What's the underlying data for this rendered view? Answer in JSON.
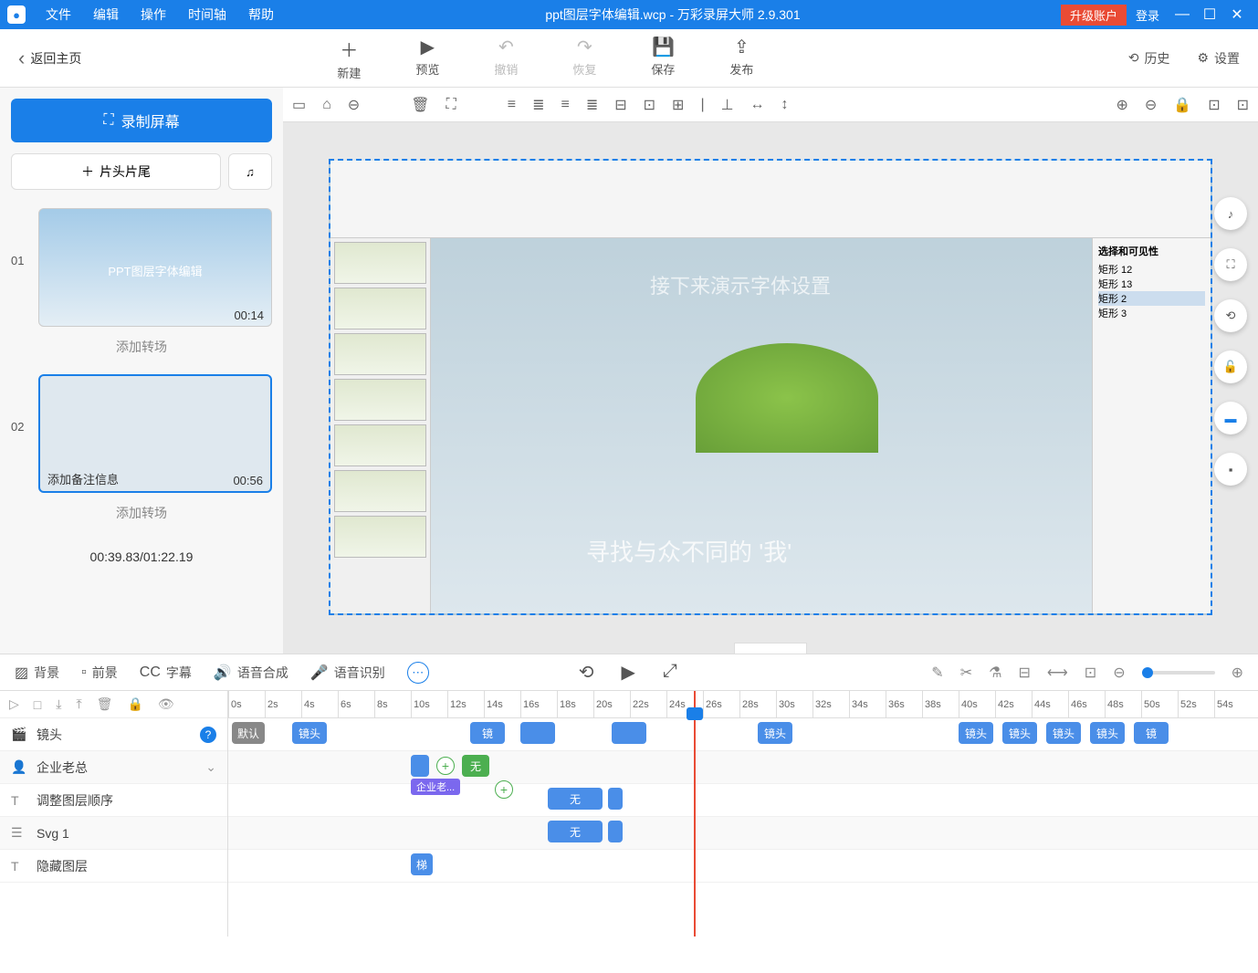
{
  "titlebar": {
    "menus": [
      "文件",
      "编辑",
      "操作",
      "时间轴",
      "帮助"
    ],
    "title": "ppt图层字体编辑.wcp - 万彩录屏大师 2.9.301",
    "upgrade": "升级账户",
    "login": "登录"
  },
  "toolbar": {
    "back": "返回主页",
    "items": [
      {
        "icon": "＋",
        "label": "新建"
      },
      {
        "icon": "▶",
        "label": "预览"
      },
      {
        "icon": "↶",
        "label": "撤销",
        "disabled": true
      },
      {
        "icon": "↷",
        "label": "恢复",
        "disabled": true
      },
      {
        "icon": "💾",
        "label": "保存"
      },
      {
        "icon": "⇪",
        "label": "发布"
      }
    ],
    "history": "历史",
    "settings": "设置"
  },
  "leftPanel": {
    "record": "录制屏幕",
    "headTail": "片头片尾",
    "scenes": [
      {
        "num": "01",
        "title": "PPT图层字体编辑",
        "duration": "00:14"
      },
      {
        "num": "02",
        "note": "添加备注信息",
        "duration": "00:56",
        "selected": true
      }
    ],
    "addTransition": "添加转场",
    "timeCounter": "00:39.83/01:22.19"
  },
  "canvasToolbar": {
    "left": [
      "▭",
      "⌂",
      "⊖",
      "🗑",
      "⛶",
      "≡",
      "≣",
      "≡",
      "≣",
      "⊟",
      "⊡",
      "⊞",
      "|",
      "⊥",
      "↔",
      "↕"
    ],
    "right": [
      "⊕",
      "⊖",
      "🔒",
      "⊡",
      "⊡"
    ]
  },
  "canvasOverlay": {
    "mainText": "接下来演示字体设置",
    "subText": "寻找与众不同的 '我'"
  },
  "selectionPane": {
    "title": "选择和可见性",
    "items": [
      "矩形 12",
      "矩形 13",
      "矩形 2",
      "矩形 3"
    ]
  },
  "sideFloats": [
    "♪",
    "⛶",
    "⟲",
    "🔓",
    "▬",
    "▪"
  ],
  "timelineTabs": {
    "tabs": [
      {
        "icon": "▨",
        "label": "背景"
      },
      {
        "icon": "▫",
        "label": "前景"
      },
      {
        "icon": "CC",
        "label": "字幕"
      },
      {
        "icon": "🔊",
        "label": "语音合成"
      },
      {
        "icon": "🎤",
        "label": "语音识别"
      }
    ],
    "center": [
      "⟲",
      "▶",
      "⤢"
    ],
    "right": [
      "✎",
      "✂",
      "⚗",
      "⊟",
      "⟷",
      "⊡",
      "⊖",
      "⊕"
    ]
  },
  "ruler": [
    "0s",
    "2s",
    "4s",
    "6s",
    "8s",
    "10s",
    "12s",
    "14s",
    "16s",
    "18s",
    "20s",
    "22s",
    "24s",
    "26s",
    "28s",
    "30s",
    "32s",
    "34s",
    "36s",
    "38s",
    "40s",
    "42s",
    "44s",
    "46s",
    "48s",
    "50s",
    "52s",
    "54s"
  ],
  "tracks": [
    {
      "icon": "🎬",
      "label": "镜头",
      "help": true
    },
    {
      "icon": "👤",
      "label": "企业老总",
      "chev": true
    },
    {
      "icon": "T",
      "label": "调整图层顺序"
    },
    {
      "icon": "☰",
      "label": "Svg 1"
    },
    {
      "icon": "T",
      "label": "隐藏图层"
    }
  ],
  "clips": {
    "shotDefault": "默认",
    "shot": "镜头",
    "none": "无",
    "label1": "企业老...",
    "label2": "梯"
  }
}
